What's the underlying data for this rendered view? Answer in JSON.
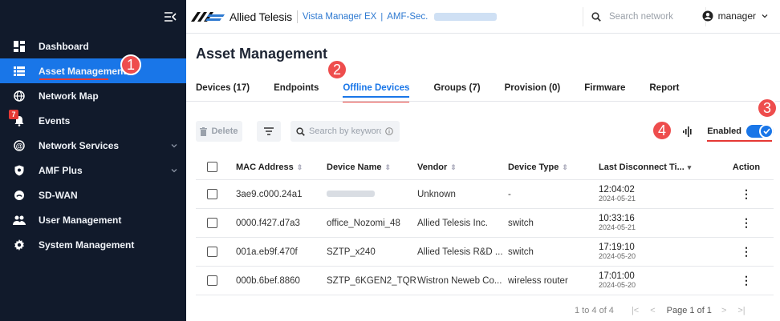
{
  "sidebar": {
    "items": [
      {
        "label": "Dashboard",
        "icon": "dashboard-icon"
      },
      {
        "label": "Asset Management",
        "icon": "list-icon",
        "active": true
      },
      {
        "label": "Network Map",
        "icon": "globe-icon"
      },
      {
        "label": "Events",
        "icon": "bell-icon",
        "badge": "7"
      },
      {
        "label": "Network Services",
        "icon": "services-icon",
        "expandable": true
      },
      {
        "label": "AMF Plus",
        "icon": "shield-icon",
        "expandable": true
      },
      {
        "label": "SD-WAN",
        "icon": "sdwan-icon"
      },
      {
        "label": "User Management",
        "icon": "users-icon"
      },
      {
        "label": "System Management",
        "icon": "gear-icon"
      }
    ]
  },
  "topbar": {
    "brand": "Allied Telesis",
    "crumbs": [
      "Vista Manager EX",
      "AMF-Sec."
    ],
    "search_placeholder": "Search network",
    "user": "manager"
  },
  "page": {
    "title": "Asset Management",
    "tabs": [
      "Devices (17)",
      "Endpoints",
      "Offline Devices",
      "Groups (7)",
      "Provision (0)",
      "Firmware",
      "Report"
    ],
    "active_tab": 2
  },
  "toolbar": {
    "delete_label": "Delete",
    "search_placeholder": "Search by keyword",
    "enabled_label": "Enabled",
    "enabled": true
  },
  "table": {
    "headers": [
      "MAC Address",
      "Device Name",
      "Vendor",
      "Device Type",
      "Last Disconnect Ti...",
      "Action"
    ],
    "rows": [
      {
        "mac": "3ae9.c000.24a1",
        "name": "",
        "vendor": "Unknown",
        "type": "-",
        "time": "12:04:02",
        "date": "2024-05-21"
      },
      {
        "mac": "0000.f427.d7a3",
        "name": "office_Nozomi_48",
        "vendor": "Allied Telesis Inc.",
        "type": "switch",
        "time": "10:33:16",
        "date": "2024-05-21"
      },
      {
        "mac": "001a.eb9f.470f",
        "name": "SZTP_x240",
        "vendor": "Allied Telesis R&D ...",
        "type": "switch",
        "time": "17:19:10",
        "date": "2024-05-20"
      },
      {
        "mac": "000b.6bef.8860",
        "name": "SZTP_6KGEN2_TQR",
        "vendor": "Wistron Neweb Co...",
        "type": "wireless router",
        "time": "17:01:00",
        "date": "2024-05-20"
      }
    ]
  },
  "pagination": {
    "range": "1 to 4 of 4",
    "page": "Page 1 of 1"
  },
  "callouts": [
    "1",
    "2",
    "3",
    "4"
  ],
  "colors": {
    "sidebar_bg": "#111a2b",
    "accent": "#1976e8",
    "callout": "#ee4d4d"
  }
}
